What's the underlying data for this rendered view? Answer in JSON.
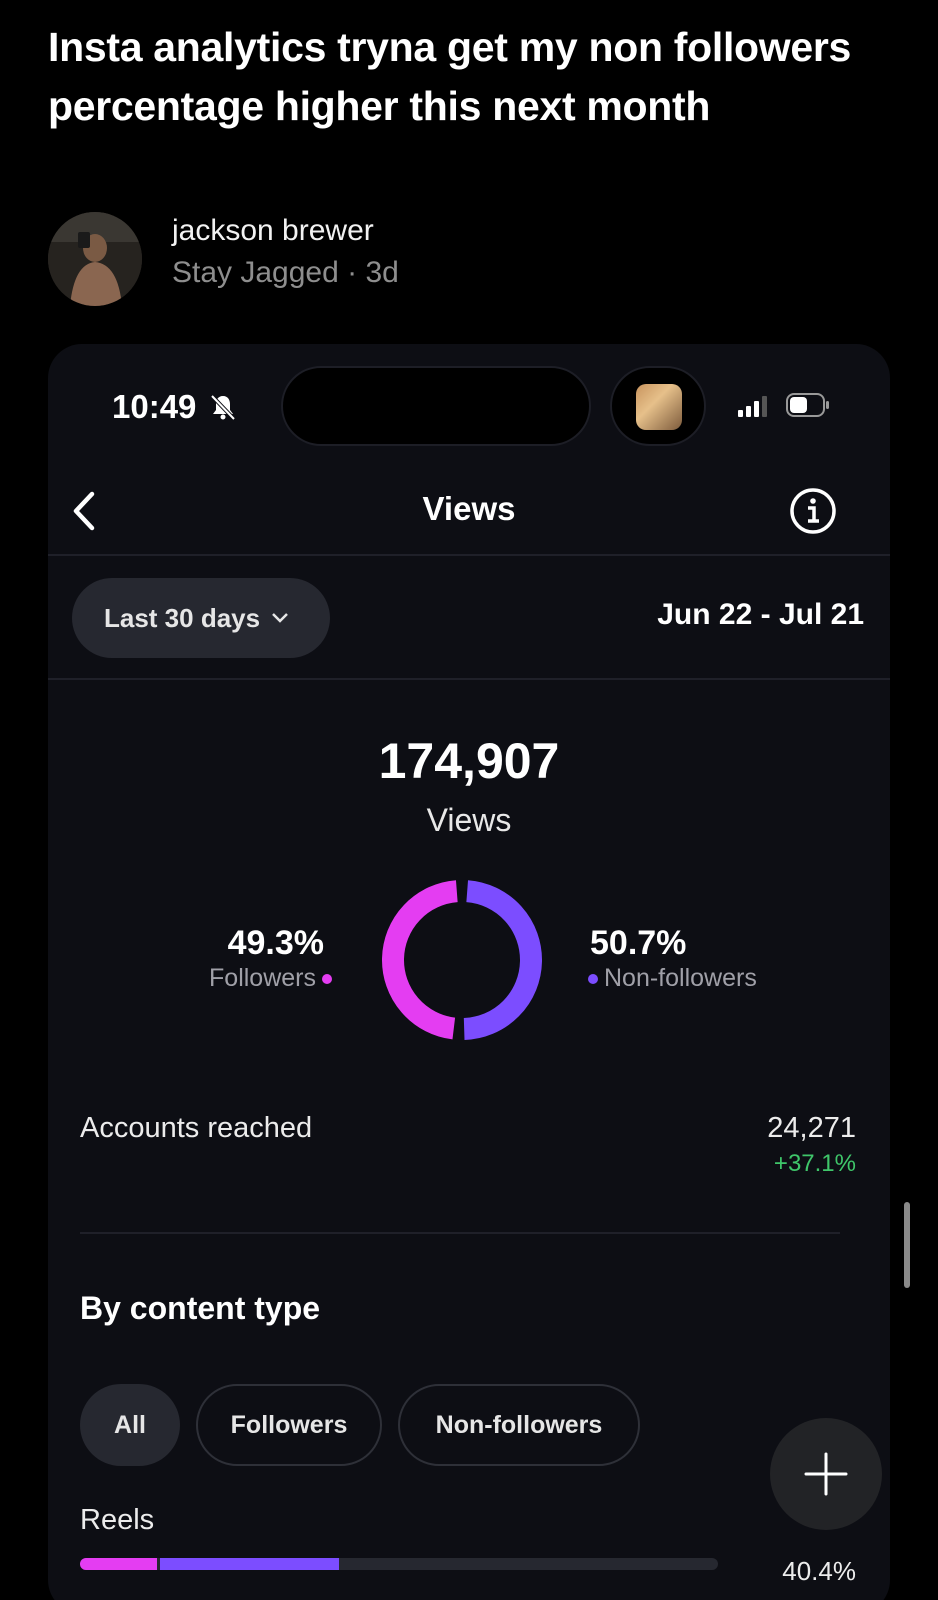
{
  "post": {
    "title": "Insta analytics tryna get my non followers percentage higher this next month",
    "author_name": "jackson brewer",
    "author_meta": "Stay Jagged · 3d"
  },
  "status_bar": {
    "time": "10:49"
  },
  "header": {
    "title": "Views"
  },
  "filters": {
    "range_label": "Last 30 days",
    "date_range": "Jun 22 - Jul 21"
  },
  "summary": {
    "total_views": "174,907",
    "total_label": "Views",
    "followers_pct": "49.3%",
    "followers_label": "Followers",
    "nonfollowers_pct": "50.7%",
    "nonfollowers_label": "Non-followers",
    "followers_fraction": 0.493,
    "nonfollowers_fraction": 0.507
  },
  "reach": {
    "label": "Accounts reached",
    "value": "24,271",
    "change": "+37.1%"
  },
  "content_type": {
    "title": "By content type",
    "chips": [
      {
        "label": "All"
      },
      {
        "label": "Followers"
      },
      {
        "label": "Non-followers"
      }
    ],
    "reels_label": "Reels",
    "reels_pct": "40.4%",
    "reels_followers_fraction": 0.12,
    "reels_nonfollowers_fraction": 0.28
  },
  "colors": {
    "followers": "#e43df2",
    "nonfollowers": "#7c4dff",
    "positive": "#3fc66a",
    "background": "#0d0e14"
  },
  "icons": [
    "bell-muted-icon",
    "signal-icon",
    "battery-icon",
    "back-chevron-icon",
    "info-icon",
    "chevron-down-icon",
    "plus-icon"
  ]
}
